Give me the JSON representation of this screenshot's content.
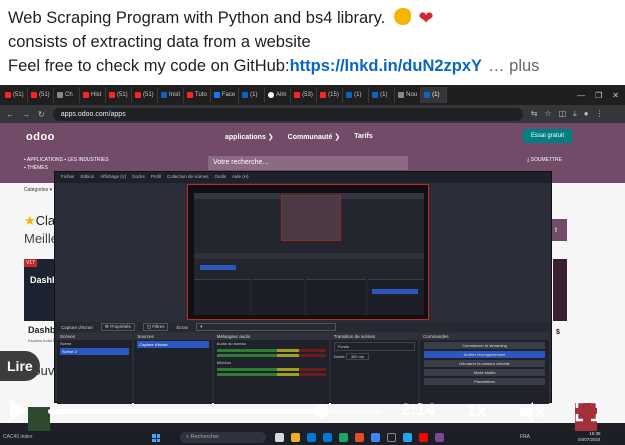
{
  "post": {
    "line1": "Web Scraping Program with Python and bs4 library.",
    "line2": "consists of extracting data from a website",
    "line3_prefix": "Feel free to check my code on GitHub:",
    "link": "https://lnkd.in/duN2zpxY",
    "more": "… plus",
    "emojis": [
      "flexed-biceps",
      "red-heart"
    ]
  },
  "browser": {
    "tabs": [
      {
        "label": "(51)",
        "icon": "youtube"
      },
      {
        "label": "(51)",
        "icon": "youtube"
      },
      {
        "label": "Ch",
        "icon": "generic"
      },
      {
        "label": "Hist",
        "icon": "youtube"
      },
      {
        "label": "(51)",
        "icon": "youtube"
      },
      {
        "label": "(51)",
        "icon": "youtube"
      },
      {
        "label": "Insti",
        "icon": "linkedin"
      },
      {
        "label": "Tuto",
        "icon": "youtube"
      },
      {
        "label": "Face",
        "icon": "facebook"
      },
      {
        "label": "(1)",
        "icon": "linkedin"
      },
      {
        "label": "Alm",
        "icon": "github"
      },
      {
        "label": "(53)",
        "icon": "youtube"
      },
      {
        "label": "(15)",
        "icon": "youtube"
      },
      {
        "label": "(1)",
        "icon": "linkedin"
      },
      {
        "label": "(1)",
        "icon": "linkedin"
      },
      {
        "label": "Nou",
        "icon": "generic"
      },
      {
        "label": "(1)",
        "icon": "linkedin"
      }
    ],
    "url": "apps.odoo.com/apps"
  },
  "odoo": {
    "logo": "odoo",
    "menu": [
      "applications ❯",
      "Communauté ❯",
      "Tarifs"
    ],
    "cta": "Essai gratuit",
    "apps_label": "APPLICATIONS",
    "industries_label": "LES INDUSTRIES",
    "themes_label": "THÈMES",
    "search_placeholder": "Votre recherche...",
    "submit_label": "SOUMETTRE",
    "categories": "Catégories",
    "classic": "Class",
    "meilleur": "Meilleu",
    "card_badge": "V17",
    "card_title": "Dashb",
    "card_label": "Dashboa",
    "card_vendor": "Ksolves India L",
    "nouveau": "Nouve",
    "price": "$"
  },
  "obs": {
    "menu": [
      "Fichier",
      "Édition",
      "Affichage (V)",
      "Docks",
      "Profil",
      "Collection de scènes",
      "Outils",
      "Aide (H)"
    ],
    "toolbar": {
      "source": "Capture d'écran",
      "properties": "Propriétés",
      "filters": "Filtres",
      "screen_label": "Écran"
    },
    "docks": {
      "scenes": {
        "title": "Scènes",
        "items": [
          "Scène",
          "Scène 2"
        ]
      },
      "sources": {
        "title": "Sources",
        "items": [
          "Capture d'écran"
        ]
      },
      "mixer": {
        "title": "Mélangeur audio",
        "items": [
          "Audio du bureau",
          "Mic/Aux"
        ]
      },
      "transitions": {
        "title": "Transition de scènes",
        "fade": "Fondu",
        "duration_label": "Durée",
        "duration": "300 ms"
      },
      "controls": {
        "title": "Commandes",
        "buttons": [
          "Commencer le streaming",
          "Arrêter l'enregistrement",
          "Démarrer la caméra virtuelle",
          "Mode studio",
          "Paramètres"
        ]
      }
    }
  },
  "player": {
    "lire": "Lire",
    "time": "2:14",
    "speed": "1x",
    "progress_fraction": 0.82
  },
  "taskbar": {
    "left": "CAC40 index",
    "search": "Rechercher",
    "lang": "FRA",
    "clock_time": "15:36",
    "clock_date": "04/07/2024"
  }
}
